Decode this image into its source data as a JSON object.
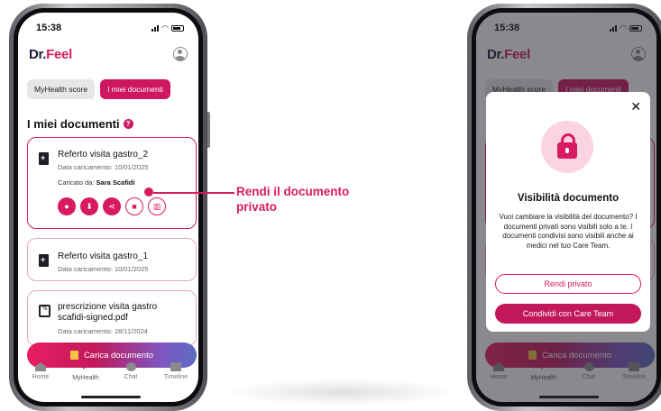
{
  "status_bar": {
    "time": "15:38"
  },
  "app": {
    "logo_main": "Dr.",
    "logo_accent": "Feel"
  },
  "tabs": [
    {
      "label": "MyHealth score",
      "active": false
    },
    {
      "label": "I miei documenti",
      "active": true
    }
  ],
  "section": {
    "title": "I miei documenti"
  },
  "documents": [
    {
      "title": "Referto visita gastro_2",
      "date": "Data caricamento: 10/01/2025",
      "uploader_label": "Caricato da:",
      "uploader_name": "Sara Scafidi",
      "selected": true
    },
    {
      "title": "Referto visita gastro_1",
      "date": "Data caricamento: 10/01/2025"
    },
    {
      "title": "prescrizione visita gastro scafidi-signed.pdf",
      "date": "Data caricamento: 28/11/2024"
    }
  ],
  "actions": [
    "eye-icon",
    "download-icon",
    "share-icon",
    "lock-icon",
    "trash-icon"
  ],
  "upload_button": {
    "label": "Carica documento"
  },
  "bottom_nav": [
    {
      "label": "Home",
      "icon": "home-icon"
    },
    {
      "label": "MyHealth",
      "icon": "heart-icon"
    },
    {
      "label": "Chat",
      "icon": "chat-icon"
    },
    {
      "label": "Timeline",
      "icon": "timeline-icon"
    }
  ],
  "annotation": {
    "text": "Rendi il documento privato"
  },
  "modal": {
    "title": "Visibilità documento",
    "body": "Vuoi cambiare la visibilità del documento? I documenti privati sono visibili solo a te. I documenti condivisi sono visibili anche ai medici nel tuo Care Team.",
    "btn_private": "Rendi privato",
    "btn_share": "Condividi con Care Team"
  },
  "colors": {
    "brand": "#d81b60",
    "brand_dark": "#c2185b",
    "logo_dark": "#1c1c3a"
  }
}
